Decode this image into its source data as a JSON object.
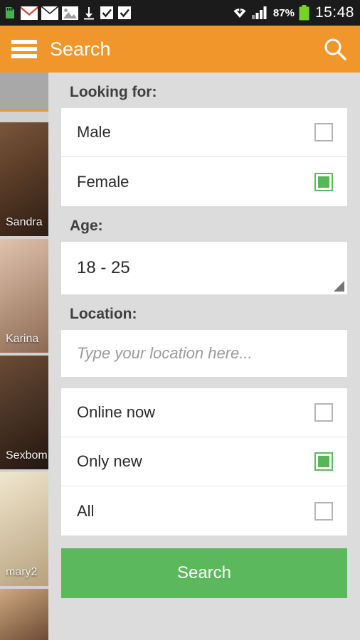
{
  "statusbar": {
    "icons": [
      "sd-card-icon",
      "gmail-icon",
      "mail-icon",
      "photo-icon",
      "download-icon",
      "task-done-icon",
      "task-done-icon-2"
    ],
    "right_icons": [
      "wifi-icon",
      "signal-icon"
    ],
    "battery_percent": "87%",
    "time": "15:48"
  },
  "actionbar": {
    "menu_icon": "hamburger-menu-icon",
    "title": "Search",
    "search_icon": "search-icon"
  },
  "background_list": {
    "items": [
      {
        "name": "Sandra",
        "color1": "#6b4a33",
        "color2": "#3a2418"
      },
      {
        "name": "Karina",
        "color1": "#d8b9a4",
        "color2": "#8e6a54"
      },
      {
        "name": "Sexbom",
        "color1": "#5e4433",
        "color2": "#2d1d13"
      },
      {
        "name": "mary2",
        "color1": "#e8dcc3",
        "color2": "#b9a37f"
      }
    ]
  },
  "panel": {
    "looking_for": {
      "label": "Looking for:",
      "options": [
        {
          "label": "Male",
          "checked": false
        },
        {
          "label": "Female",
          "checked": true
        }
      ]
    },
    "age": {
      "label": "Age:",
      "value": "18 - 25"
    },
    "location": {
      "label": "Location:",
      "placeholder": "Type your location here...",
      "value": ""
    },
    "filters": [
      {
        "label": "Online now",
        "checked": false
      },
      {
        "label": "Only new",
        "checked": true
      },
      {
        "label": "All",
        "checked": false
      }
    ],
    "search_button": "Search"
  },
  "colors": {
    "accent": "#f0962a",
    "green": "#5cb85c",
    "panel_bg": "#dcdcdc",
    "statusbar_bg": "#1b1b1b"
  }
}
